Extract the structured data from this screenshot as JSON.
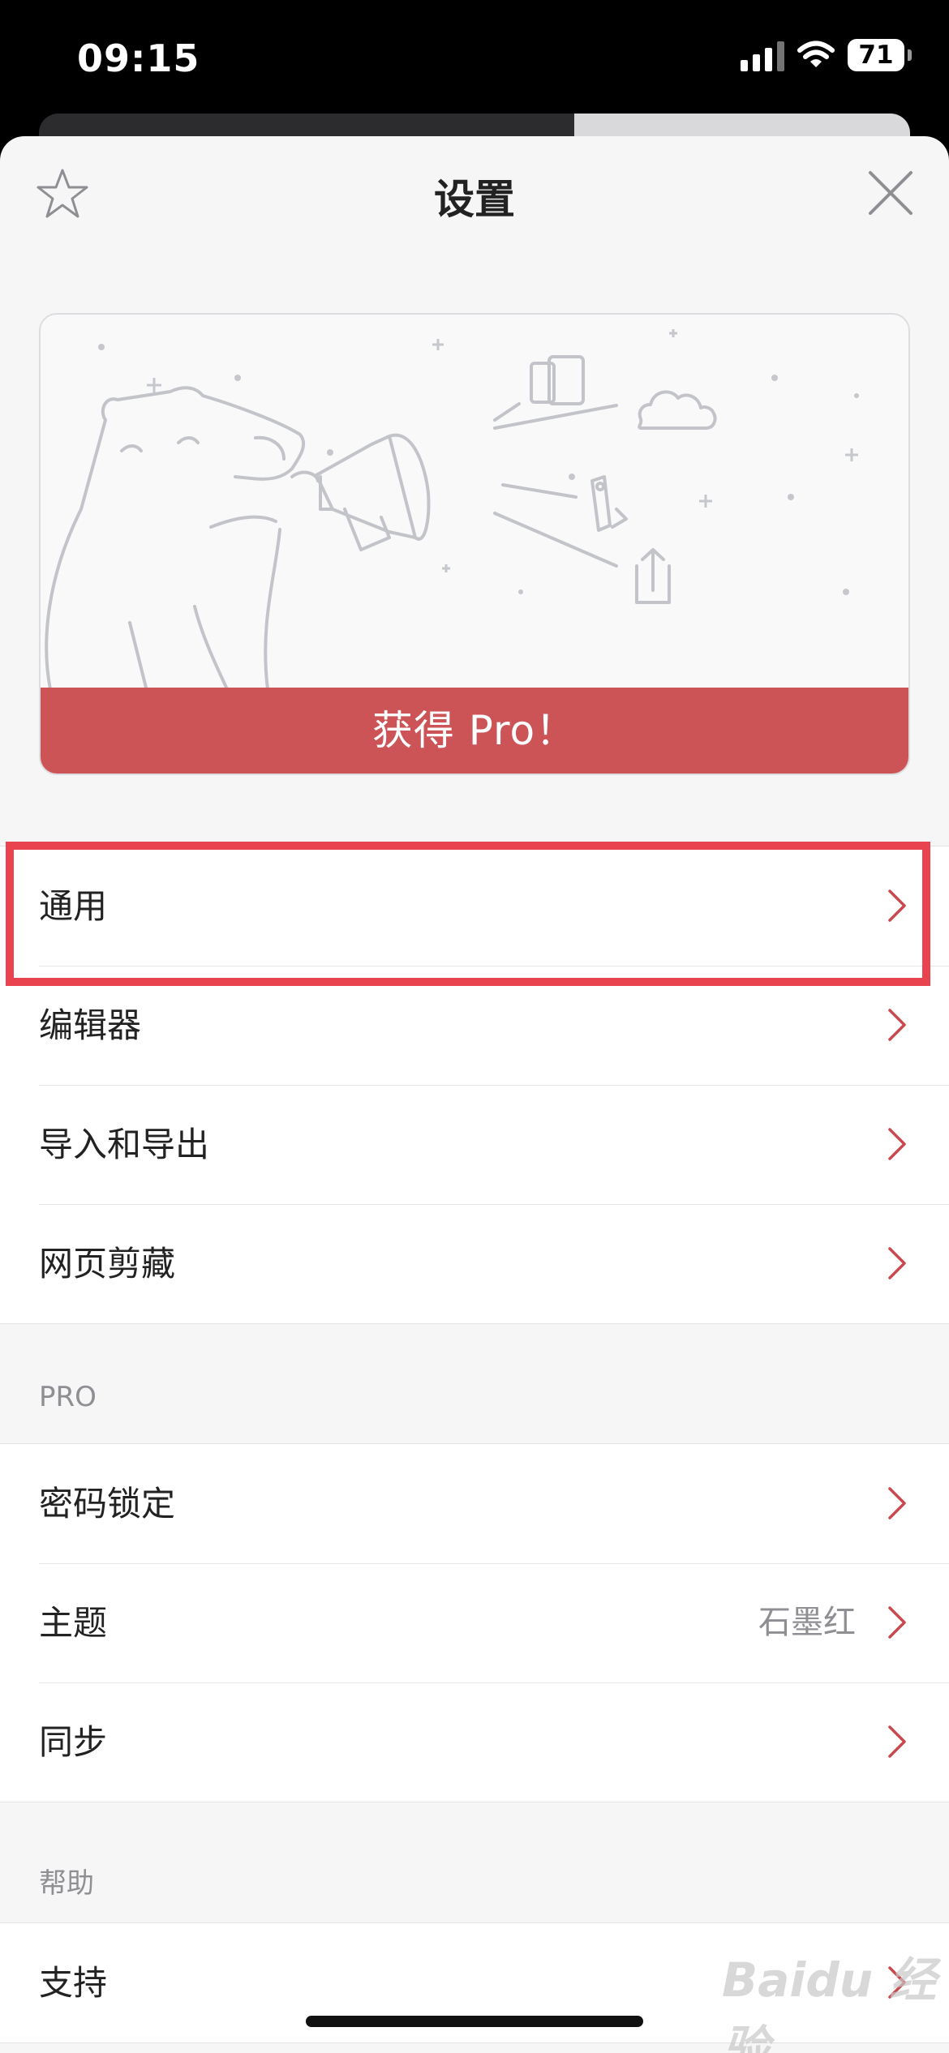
{
  "status_bar": {
    "time": "09:15",
    "battery": "71"
  },
  "header": {
    "title": "设置"
  },
  "promo": {
    "button_label": "获得 Pro！"
  },
  "general_group": {
    "items": [
      {
        "label": "通用"
      },
      {
        "label": "编辑器"
      },
      {
        "label": "导入和导出"
      },
      {
        "label": "网页剪藏"
      }
    ]
  },
  "pro_group": {
    "header": "PRO",
    "items": [
      {
        "label": "密码锁定"
      },
      {
        "label": "主题",
        "value": "石墨红"
      },
      {
        "label": "同步"
      }
    ]
  },
  "help_group": {
    "header": "帮助",
    "items": [
      {
        "label": "支持"
      }
    ]
  },
  "watermark": "Baidu 经验",
  "colors": {
    "accent": "#cc5356",
    "chevron": "#c9494e",
    "highlight": "#e8434f"
  },
  "icons": [
    "star-icon",
    "close-icon",
    "chevron-right-icon",
    "signal-icon",
    "wifi-icon",
    "battery-icon"
  ]
}
